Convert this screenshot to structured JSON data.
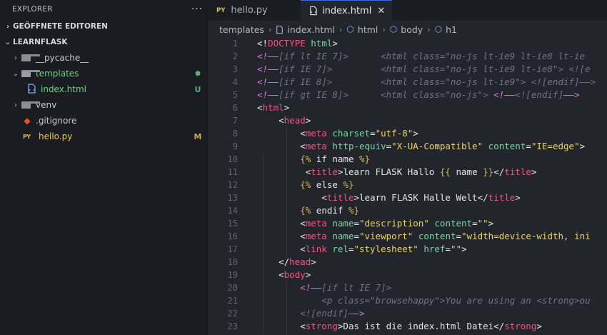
{
  "explorer": {
    "title": "EXPLORER",
    "more": "···",
    "open_editors": "GEÖFFNETE EDITOREN",
    "project": "LEARNFLASK",
    "items": [
      {
        "label": "__pycache__",
        "badge": ""
      },
      {
        "label": "templates",
        "badge": "●"
      },
      {
        "label": "index.html",
        "badge": "U"
      },
      {
        "label": "venv",
        "badge": ""
      },
      {
        "label": ".gitignore",
        "badge": ""
      },
      {
        "label": "hello.py",
        "badge": "M"
      }
    ]
  },
  "tabs": [
    {
      "label": "hello.py",
      "icon": "PY"
    },
    {
      "label": "index.html",
      "close": "✕"
    }
  ],
  "breadcrumb": [
    "templates",
    "index.html",
    "html",
    "body",
    "h1"
  ],
  "editor": {
    "lines": [
      [
        [
          "t-punc",
          "<!"
        ],
        [
          "t-doctype",
          "DOCTYPE"
        ],
        [
          "t-punc",
          " "
        ],
        [
          "t-attr",
          "html"
        ],
        [
          "t-punc",
          ">"
        ]
      ],
      [
        [
          "t-cmt-mark",
          "<!——"
        ],
        [
          "t-cmt",
          "[if lt IE 7]>      <html class=\"no-js lt-ie9 lt-ie8 lt-ie"
        ]
      ],
      [
        [
          "t-cmt-mark",
          "<!——"
        ],
        [
          "t-cmt",
          "[if IE 7]>         <html class=\"no-js lt-ie9 lt-ie8\"> <![e"
        ]
      ],
      [
        [
          "t-cmt-mark",
          "<!——"
        ],
        [
          "t-cmt",
          "[if IE 8]>         <html class=\"no-js lt-ie9\"> <![endif]——>"
        ]
      ],
      [
        [
          "t-cmt-mark",
          "<!——"
        ],
        [
          "t-cmt",
          "[if gt IE 8]>      <html class=\"no-js\"> "
        ],
        [
          "t-cmt-mark",
          "<!——"
        ],
        [
          "t-cmt",
          "<![endif]"
        ],
        [
          "t-cmt-mark",
          "——>"
        ]
      ],
      [
        [
          "t-punc",
          "<"
        ],
        [
          "t-tag",
          "html"
        ],
        [
          "t-punc",
          ">"
        ]
      ],
      [
        [
          "t-punc",
          "    <"
        ],
        [
          "t-tag",
          "head"
        ],
        [
          "t-punc",
          ">"
        ]
      ],
      [
        [
          "t-punc",
          "        <"
        ],
        [
          "t-tag",
          "meta"
        ],
        [
          "t-punc",
          " "
        ],
        [
          "t-attr",
          "charset"
        ],
        [
          "t-punc",
          "="
        ],
        [
          "t-str",
          "\"utf-8\""
        ],
        [
          "t-punc",
          ">"
        ]
      ],
      [
        [
          "t-punc",
          "        <"
        ],
        [
          "t-tag",
          "meta"
        ],
        [
          "t-punc",
          " "
        ],
        [
          "t-attr",
          "http-equiv"
        ],
        [
          "t-punc",
          "="
        ],
        [
          "t-str",
          "\"X-UA-Compatible\""
        ],
        [
          "t-punc",
          " "
        ],
        [
          "t-attr",
          "content"
        ],
        [
          "t-punc",
          "="
        ],
        [
          "t-str",
          "\"IE=edge\""
        ],
        [
          "t-punc",
          ">"
        ]
      ],
      [
        [
          "t-punc",
          "        "
        ],
        [
          "t-tpl",
          "{%"
        ],
        [
          "t-text",
          " if name "
        ],
        [
          "t-tpl",
          "%}"
        ]
      ],
      [
        [
          "t-punc",
          "         <"
        ],
        [
          "t-tag",
          "title"
        ],
        [
          "t-punc",
          ">"
        ],
        [
          "t-text",
          "learn FLASK Hallo "
        ],
        [
          "t-tpl",
          "{{"
        ],
        [
          "t-text",
          " name "
        ],
        [
          "t-tpl",
          "}}"
        ],
        [
          "t-punc",
          "</"
        ],
        [
          "t-tag",
          "title"
        ],
        [
          "t-punc",
          ">"
        ]
      ],
      [
        [
          "t-punc",
          "        "
        ],
        [
          "t-tpl",
          "{%"
        ],
        [
          "t-text",
          " else "
        ],
        [
          "t-tpl",
          "%}"
        ]
      ],
      [
        [
          "t-punc",
          "            <"
        ],
        [
          "t-tag",
          "title"
        ],
        [
          "t-punc",
          ">"
        ],
        [
          "t-text",
          "learn FLASK Halle Welt"
        ],
        [
          "t-punc",
          "</"
        ],
        [
          "t-tag",
          "title"
        ],
        [
          "t-punc",
          ">"
        ]
      ],
      [
        [
          "t-punc",
          "        "
        ],
        [
          "t-tpl",
          "{%"
        ],
        [
          "t-text",
          " endif "
        ],
        [
          "t-tpl",
          "%}"
        ]
      ],
      [
        [
          "t-punc",
          "        <"
        ],
        [
          "t-tag",
          "meta"
        ],
        [
          "t-punc",
          " "
        ],
        [
          "t-attr",
          "name"
        ],
        [
          "t-punc",
          "="
        ],
        [
          "t-str",
          "\"description\""
        ],
        [
          "t-punc",
          " "
        ],
        [
          "t-attr",
          "content"
        ],
        [
          "t-punc",
          "="
        ],
        [
          "t-str",
          "\"\""
        ],
        [
          "t-punc",
          ">"
        ]
      ],
      [
        [
          "t-punc",
          "        <"
        ],
        [
          "t-tag",
          "meta"
        ],
        [
          "t-punc",
          " "
        ],
        [
          "t-attr",
          "name"
        ],
        [
          "t-punc",
          "="
        ],
        [
          "t-str",
          "\"viewport\""
        ],
        [
          "t-punc",
          " "
        ],
        [
          "t-attr",
          "content"
        ],
        [
          "t-punc",
          "="
        ],
        [
          "t-str",
          "\"width=device-width, ini"
        ]
      ],
      [
        [
          "t-punc",
          "        <"
        ],
        [
          "t-tag",
          "link"
        ],
        [
          "t-punc",
          " "
        ],
        [
          "t-attr",
          "rel"
        ],
        [
          "t-punc",
          "="
        ],
        [
          "t-str",
          "\"stylesheet\""
        ],
        [
          "t-punc",
          " "
        ],
        [
          "t-attr",
          "href"
        ],
        [
          "t-punc",
          "="
        ],
        [
          "t-str",
          "\"\""
        ],
        [
          "t-punc",
          ">"
        ]
      ],
      [
        [
          "t-punc",
          "    </"
        ],
        [
          "t-tag",
          "head"
        ],
        [
          "t-punc",
          ">"
        ]
      ],
      [
        [
          "t-punc",
          "    <"
        ],
        [
          "t-tag",
          "body"
        ],
        [
          "t-punc",
          ">"
        ]
      ],
      [
        [
          "t-punc",
          "        "
        ],
        [
          "t-cmt-mark",
          "<!——"
        ],
        [
          "t-cmt",
          "[if lt IE 7]>"
        ]
      ],
      [
        [
          "t-cmt",
          "            <p class=\"browsehappy\">You are using an <strong>ou"
        ]
      ],
      [
        [
          "t-punc",
          "        "
        ],
        [
          "t-cmt",
          "<![endif]"
        ],
        [
          "t-cmt-mark",
          "——>"
        ]
      ],
      [
        [
          "t-punc",
          "        <"
        ],
        [
          "t-tag",
          "strong"
        ],
        [
          "t-punc",
          ">"
        ],
        [
          "t-text",
          "Das ist die index.html Datei"
        ],
        [
          "t-punc",
          "</"
        ],
        [
          "t-tag",
          "strong"
        ],
        [
          "t-punc",
          ">"
        ]
      ]
    ]
  }
}
